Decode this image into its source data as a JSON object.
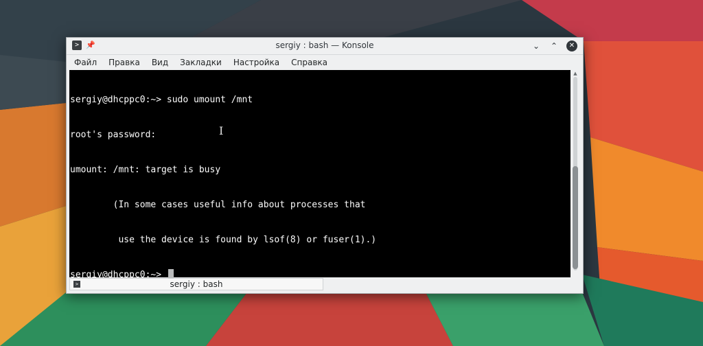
{
  "window": {
    "title": "sergiy : bash — Konsole",
    "app_icon": "terminal-icon",
    "pin_icon": "pin-icon",
    "buttons": {
      "minimize": "chevron-down-icon",
      "maximize": "chevron-up-icon",
      "close": "close-icon"
    }
  },
  "menu": {
    "items": [
      "Файл",
      "Правка",
      "Вид",
      "Закладки",
      "Настройка",
      "Справка"
    ]
  },
  "terminal": {
    "lines": [
      "sergiy@dhcppc0:~> sudo umount /mnt",
      "root's password:",
      "umount: /mnt: target is busy",
      "        (In some cases useful info about processes that",
      "         use the device is found by lsof(8) or fuser(1).)"
    ],
    "prompt": "sergiy@dhcppc0:~> "
  },
  "tab": {
    "label": "sergiy : bash",
    "icon": "terminal-icon"
  },
  "colors": {
    "terminal_bg": "#000000",
    "terminal_fg": "#fcfcfc",
    "chrome_bg": "#eff0f1"
  }
}
